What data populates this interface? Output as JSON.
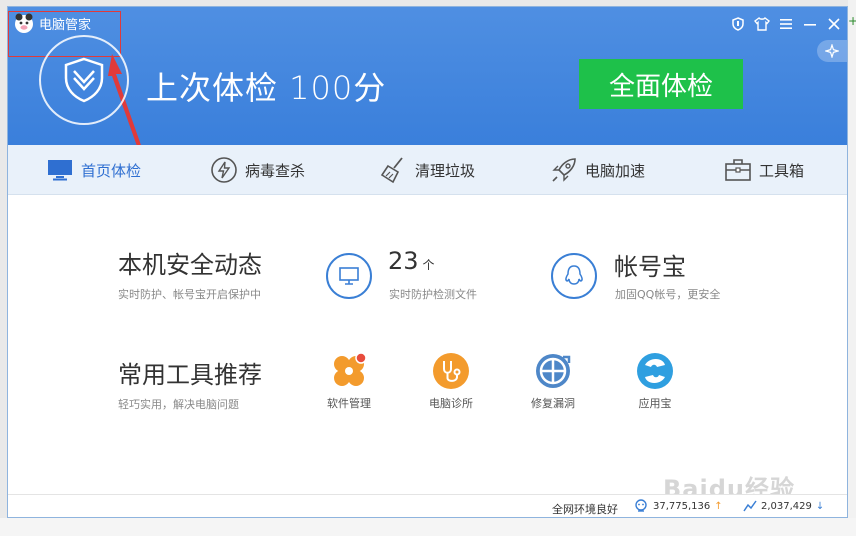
{
  "app": {
    "title": "电脑管家"
  },
  "header": {
    "score_text": "上次体检 100分",
    "fullcheck_label": "全面体检"
  },
  "nav": {
    "items": [
      {
        "label": "首页体检",
        "icon": "monitor-icon"
      },
      {
        "label": "病毒查杀",
        "icon": "lightning-icon"
      },
      {
        "label": "清理垃圾",
        "icon": "broom-icon"
      },
      {
        "label": "电脑加速",
        "icon": "rocket-icon"
      },
      {
        "label": "工具箱",
        "icon": "toolbox-icon"
      }
    ]
  },
  "security": {
    "title": "本机安全动态",
    "subtitle": "实时防护、帐号宝开启保护中",
    "monitor_count": "23",
    "monitor_unit": "个",
    "monitor_sub": "实时防护检测文件",
    "account_title": "帐号宝",
    "account_sub": "加固QQ帐号，更安全"
  },
  "tools": {
    "title": "常用工具推荐",
    "subtitle": "轻巧实用，解决电脑问题",
    "items": [
      {
        "label": "软件管理",
        "icon": "software-manager-icon"
      },
      {
        "label": "电脑诊所",
        "icon": "stethoscope-icon"
      },
      {
        "label": "修复漏洞",
        "icon": "repair-icon"
      },
      {
        "label": "应用宝",
        "icon": "app-store-icon"
      }
    ]
  },
  "status": {
    "network": "全网环境良好",
    "users_count": "37,775,136",
    "protect_count": "2,037,429"
  },
  "watermark": "Baidu经验",
  "colors": {
    "header_blue": "#3a7fdb",
    "accent_green": "#1ec14a",
    "nav_active": "#2f6fd1",
    "annotation_red": "#e03a3a",
    "tool_orange": "#f39b2d",
    "tool_blue": "#2f9fe0"
  }
}
